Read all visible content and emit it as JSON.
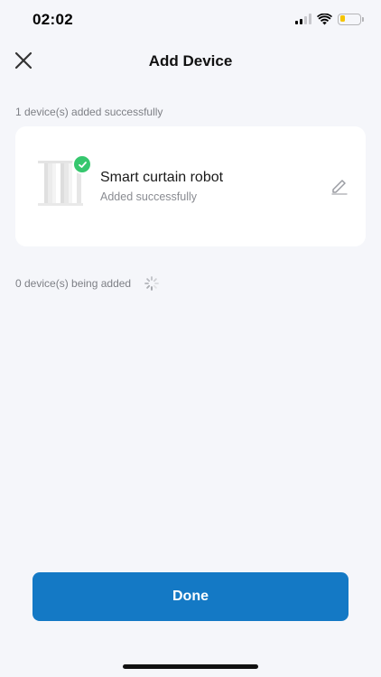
{
  "status_bar": {
    "time": "02:02",
    "icons": [
      "signal-icon",
      "wifi-icon",
      "battery-icon"
    ],
    "battery_color": "#f5c400"
  },
  "nav": {
    "title": "Add Device",
    "close_icon": "close-icon"
  },
  "success_section": {
    "label": "1 device(s) added successfully"
  },
  "device": {
    "name": "Smart curtain robot",
    "status": "Added successfully",
    "image_icon": "curtain-icon",
    "badge_icon": "check-icon",
    "edit_icon": "pencil-icon"
  },
  "adding_section": {
    "label": "0 device(s) being added",
    "spinner_icon": "spinner-icon"
  },
  "footer": {
    "done_label": "Done"
  },
  "colors": {
    "accent": "#1479c5",
    "success": "#36c76e",
    "background": "#f5f6fa"
  }
}
